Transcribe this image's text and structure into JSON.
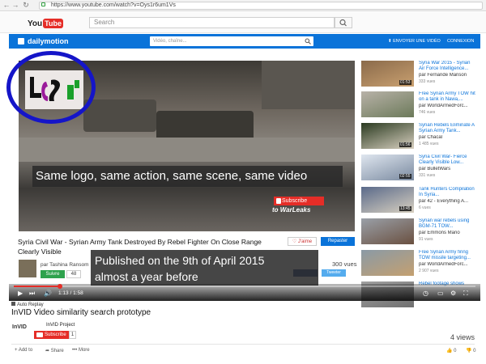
{
  "browser": {
    "url": "https://www.youtube.com/watch?v=Oys1r6um1Vs"
  },
  "youtube": {
    "logo_you": "You",
    "logo_tube": "Tube",
    "search_placeholder": "Search"
  },
  "dailymotion": {
    "brand": "dailymotion",
    "search_placeholder": "Vidéo, chaîne...",
    "upload_label": "⬆ ENVOYER UNE VIDÉO",
    "login_label": "CONNEXION",
    "video_title": "Syria Civil War - Syrian Army Tank Destroyed By Rebel Fighter On Close Range Clearly Visible",
    "like_label": "♡ J'aime",
    "share_label": "Repaster",
    "author_prefix": "par",
    "author_name": "Tashina Ransom",
    "follow_label": "Suivre",
    "follow_count": "48",
    "views": "300 vues",
    "twitter_label": "Tweeter"
  },
  "overlay": {
    "caption1": "Same logo, same action, same scene, same video",
    "caption2_line1": "Published on the 9th of April 2015",
    "caption2_line2": "almost a year before",
    "subscribe_label": "Subscribe",
    "warleaks_label": "to WarLeaks"
  },
  "player": {
    "time": "1:13 / 1:58",
    "progress": 0.1,
    "auto_replay": "Auto Replay"
  },
  "sidebar": {
    "items": [
      {
        "title": "Syria War 2015 - Syrian Air Force Intelligence...",
        "author_prefix": "par",
        "author": "Fernande Manson",
        "views": "333 vues",
        "duration": "01:53"
      },
      {
        "title": "Free Syrian Army TOW hit on a tank in Nawa,...",
        "author_prefix": "par",
        "author": "WorldArmedForc...",
        "views": "746 vues",
        "duration": ""
      },
      {
        "title": "Syrian Rebels Eliminate A Syrian Army Tank...",
        "author_prefix": "par",
        "author": "Chacal",
        "views": "1 485 vues",
        "duration": "01:56"
      },
      {
        "title": "Syria Civil War- Fierce Clearly Visible Low...",
        "author_prefix": "par",
        "author": "BulletWars",
        "views": "331 vues",
        "duration": "02:55"
      },
      {
        "title": "Tank Hunters Compilation In Syria...",
        "author_prefix": "par",
        "author": "42 - Everything A...",
        "views": "6 vues",
        "duration": "13:45"
      },
      {
        "title": "Syrian war rebels using BGM-71 TOW...",
        "author_prefix": "par",
        "author": "Emmons Mario",
        "views": "91 vues",
        "duration": ""
      },
      {
        "title": "Free Syrian Army firing TOW missile targeting...",
        "author_prefix": "par",
        "author": "WorldArmedForc...",
        "views": "2 907 vues",
        "duration": ""
      },
      {
        "title": "Rebel footage shows",
        "author_prefix": "",
        "author": "",
        "views": "",
        "duration": ""
      }
    ]
  },
  "below": {
    "title": "InVID Video similarity search prototype",
    "channel_logo": "InVID",
    "channel_name": "InVID Project",
    "subscribe_label": "Subscribe",
    "subscribe_count": "1",
    "views": "4 views",
    "add_to": "Add to",
    "share": "Share",
    "more": "More",
    "likes": "0",
    "dislikes": "0"
  },
  "colors": {
    "dailymotion_blue": "#0a73d9",
    "youtube_red": "#e52d27",
    "annotation_circle": "#1515c8"
  }
}
